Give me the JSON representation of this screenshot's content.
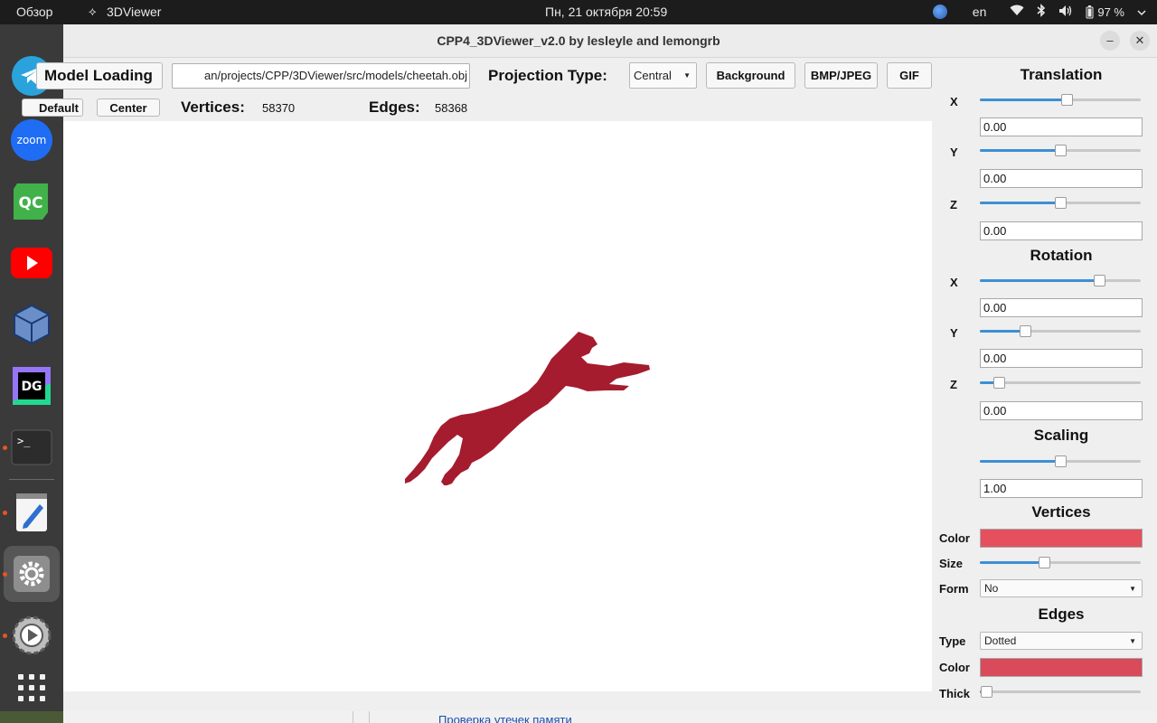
{
  "topbar": {
    "overview": "Обзор",
    "app_name": "3DViewer",
    "datetime": "Пн, 21 октября  20:59",
    "language": "en",
    "battery": "97 %"
  },
  "window": {
    "title": "CPP4_3DViewer_v2.0 by lesleyle and lemongrb",
    "minimize": "–",
    "close": "✕"
  },
  "toolbar": {
    "model_loading": "Model Loading",
    "model_loading_visible": "del Loading",
    "file_path": "an/projects/CPP/3DViewer/src/models/cheetah.obj",
    "projection_label": "Projection Type:",
    "projection_value": "Central",
    "background": "Background",
    "bmp_jpeg": "BMP/JPEG",
    "gif": "GIF",
    "default": "Default",
    "center": "Center",
    "vertices_label": "Vertices:",
    "vertices_value": "58370",
    "edges_label": "Edges:",
    "edges_value": "58368"
  },
  "panel": {
    "translation": {
      "title": "Translation",
      "x": {
        "label": "X",
        "value": "0.00",
        "slider": 0.54
      },
      "y": {
        "label": "Y",
        "value": "0.00",
        "slider": 0.5
      },
      "z": {
        "label": "Z",
        "value": "0.00",
        "slider": 0.5
      }
    },
    "rotation": {
      "title": "Rotation",
      "x": {
        "label": "X",
        "value": "0.00",
        "slider": 0.74
      },
      "y": {
        "label": "Y",
        "value": "0.00",
        "slider": 0.28
      },
      "z": {
        "label": "Z",
        "value": "0.00",
        "slider": 0.12
      }
    },
    "scaling": {
      "title": "Scaling",
      "value": "1.00",
      "slider": 0.5
    },
    "vertices": {
      "title": "Vertices",
      "color_label": "Color",
      "color": "#e5505e",
      "size_label": "Size",
      "size_slider": 0.4,
      "form_label": "Form",
      "form_value": "No"
    },
    "edges": {
      "title": "Edges",
      "type_label": "Type",
      "type_value": "Dotted",
      "color_label": "Color",
      "color": "#d94a5a",
      "thick_label": "Thick",
      "thick_slider": 0.04
    }
  },
  "model_color": "#a51c2e",
  "bottom": {
    "link": "Проверка утечек памяти"
  }
}
